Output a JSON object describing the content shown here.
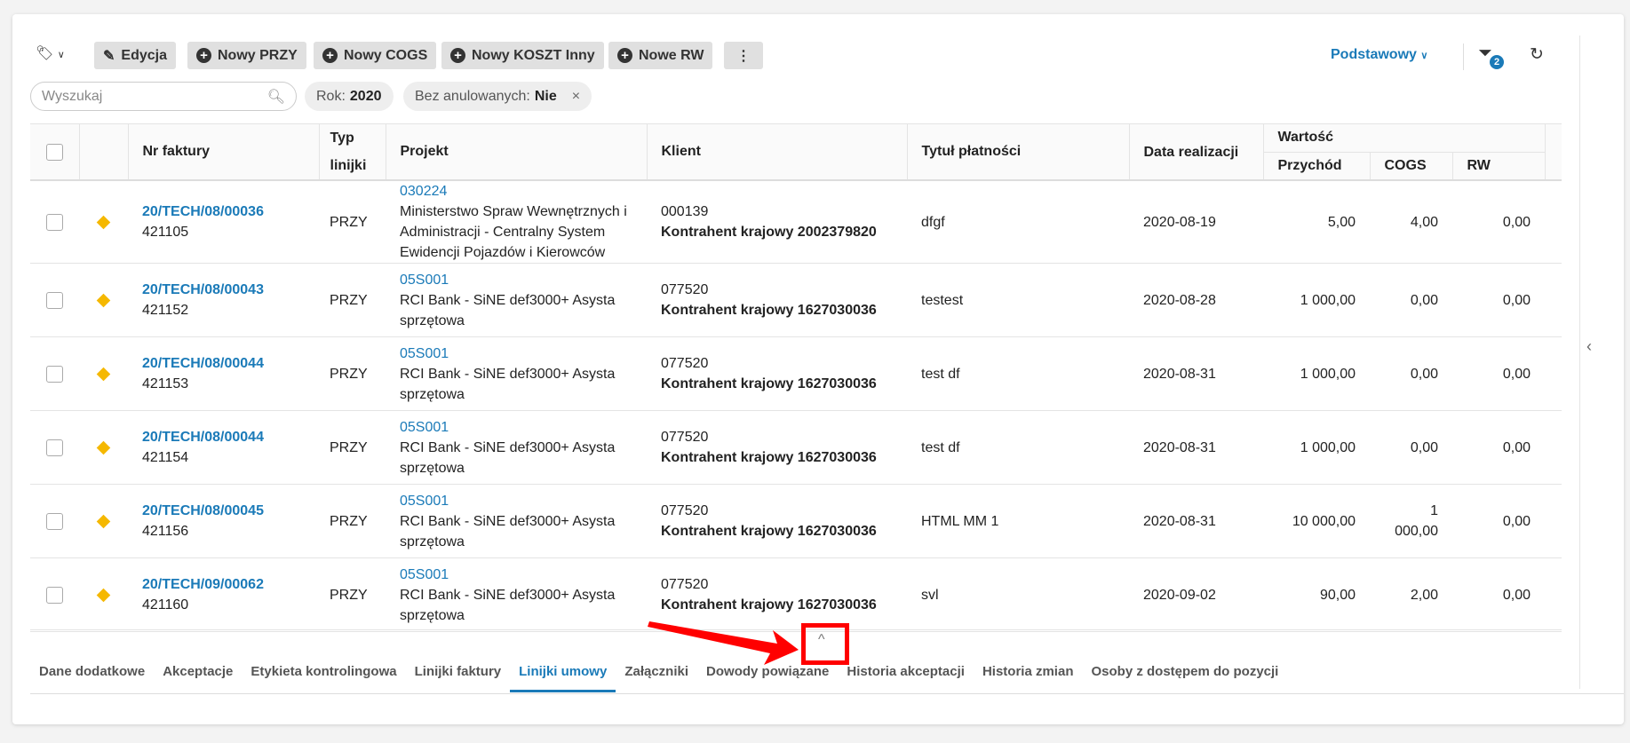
{
  "toolbar": {
    "edit": "Edycja",
    "new_przy": "Nowy PRZY",
    "new_cogs": "Nowy COGS",
    "new_koszt": "Nowy KOSZT Inny",
    "new_rw": "Nowe RW",
    "view": "Podstawowy",
    "filter_count": "2"
  },
  "search": {
    "placeholder": "Wyszukaj"
  },
  "filters": [
    {
      "label": "Rok:",
      "value": "2020"
    },
    {
      "label": "Bez anulowanych:",
      "value": "Nie"
    }
  ],
  "table": {
    "headers": {
      "nr": "Nr faktury",
      "typ": "Typ linijki",
      "projekt": "Projekt",
      "klient": "Klient",
      "tytul": "Tytuł płatności",
      "data": "Data realizacji",
      "wartosc": "Wartość",
      "przychod": "Przychód",
      "cogs": "COGS",
      "rw": "RW"
    },
    "rows": [
      {
        "nr": "20/TECH/08/00036",
        "id": "421105",
        "typ": "PRZY",
        "proj_code": "030224",
        "proj_name": "Ministerstwo Spraw Wewnętrznych i Administracji - Centralny System Ewidencji Pojazdów i Kierowców",
        "client_code": "000139",
        "client_name": "Kontrahent krajowy 2002379820",
        "tytul": "dfgf",
        "data": "2020-08-19",
        "przychod": "5,00",
        "cogs": "4,00",
        "rw": "0,00"
      },
      {
        "nr": "20/TECH/08/00043",
        "id": "421152",
        "typ": "PRZY",
        "proj_code": "05S001",
        "proj_name": "RCI Bank - SiNE def3000+ Asysta sprzętowa",
        "client_code": "077520",
        "client_name": "Kontrahent krajowy 1627030036",
        "tytul": "testest",
        "data": "2020-08-28",
        "przychod": "1 000,00",
        "cogs": "0,00",
        "rw": "0,00"
      },
      {
        "nr": "20/TECH/08/00044",
        "id": "421153",
        "typ": "PRZY",
        "proj_code": "05S001",
        "proj_name": "RCI Bank - SiNE def3000+ Asysta sprzętowa",
        "client_code": "077520",
        "client_name": "Kontrahent krajowy 1627030036",
        "tytul": "test df",
        "data": "2020-08-31",
        "przychod": "1 000,00",
        "cogs": "0,00",
        "rw": "0,00"
      },
      {
        "nr": "20/TECH/08/00044",
        "id": "421154",
        "typ": "PRZY",
        "proj_code": "05S001",
        "proj_name": "RCI Bank - SiNE def3000+ Asysta sprzętowa",
        "client_code": "077520",
        "client_name": "Kontrahent krajowy 1627030036",
        "tytul": "test df",
        "data": "2020-08-31",
        "przychod": "1 000,00",
        "cogs": "0,00",
        "rw": "0,00"
      },
      {
        "nr": "20/TECH/08/00045",
        "id": "421156",
        "typ": "PRZY",
        "proj_code": "05S001",
        "proj_name": "RCI Bank - SiNE def3000+ Asysta sprzętowa",
        "client_code": "077520",
        "client_name": "Kontrahent krajowy 1627030036",
        "tytul": "HTML MM 1",
        "data": "2020-08-31",
        "przychod": "10 000,00",
        "cogs": "1 000,00",
        "rw": "0,00"
      },
      {
        "nr": "20/TECH/09/00062",
        "id": "421160",
        "typ": "PRZY",
        "proj_code": "05S001",
        "proj_name": "RCI Bank - SiNE def3000+ Asysta sprzętowa",
        "client_code": "077520",
        "client_name": "Kontrahent krajowy 1627030036",
        "tytul": "svl",
        "data": "2020-09-02",
        "przychod": "90,00",
        "cogs": "2,00",
        "rw": "0,00"
      }
    ]
  },
  "tabs": [
    "Dane dodatkowe",
    "Akceptacje",
    "Etykieta kontrolingowa",
    "Linijki faktury",
    "Linijki umowy",
    "Załączniki",
    "Dowody powiązane",
    "Historia akceptacji",
    "Historia zmian",
    "Osoby z dostępem do pozycji"
  ],
  "active_tab": "Linijki umowy",
  "colors": {
    "accent": "#1a7ab8",
    "status": "#f5b800",
    "highlight": "#ff0000"
  }
}
